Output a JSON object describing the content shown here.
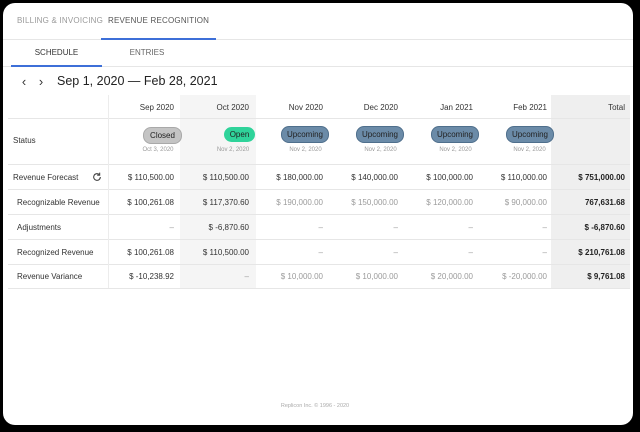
{
  "top_tabs": [
    "BILLING & INVOICING",
    "REVENUE RECOGNITION"
  ],
  "sub_tabs": [
    "SCHEDULE",
    "ENTRIES"
  ],
  "date_range": "Sep 1, 2020 — Feb 28, 2021",
  "columns": [
    "Sep 2020",
    "Oct 2020",
    "Nov 2020",
    "Dec 2020",
    "Jan 2021",
    "Feb 2021",
    "Total"
  ],
  "status": {
    "label": "Status",
    "items": [
      {
        "text": "Closed",
        "date": "Oct 3, 2020"
      },
      {
        "text": "Open",
        "date": "Nov 2, 2020"
      },
      {
        "text": "Upcoming",
        "date": "Nov 2, 2020"
      },
      {
        "text": "Upcoming",
        "date": "Nov 2, 2020"
      },
      {
        "text": "Upcoming",
        "date": "Nov 2, 2020"
      },
      {
        "text": "Upcoming",
        "date": "Nov 2, 2020"
      }
    ]
  },
  "rows": [
    {
      "label": "Revenue Forecast",
      "values": [
        "$ 110,500.00",
        "$ 110,500.00",
        "$ 180,000.00",
        "$ 140,000.00",
        "$ 100,000.00",
        "$ 110,000.00",
        "$ 751,000.00"
      ]
    },
    {
      "label": "Recognizable Revenue",
      "values": [
        "$ 100,261.08",
        "$ 117,370.60",
        "$ 190,000.00",
        "$ 150,000.00",
        "$ 120,000.00",
        "$ 90,000.00",
        "767,631.68"
      ]
    },
    {
      "label": "Adjustments",
      "values": [
        "–",
        "$ -6,870.60",
        "–",
        "–",
        "–",
        "–",
        "$ -6,870.60"
      ]
    },
    {
      "label": "Recognized Revenue",
      "values": [
        "$ 100,261.08",
        "$ 110,500.00",
        "–",
        "–",
        "–",
        "–",
        "$ 210,761.08"
      ]
    },
    {
      "label": "Revenue Variance",
      "values": [
        "$ -10,238.92",
        "–",
        "$ 10,000.00",
        "$ 10,000.00",
        "$ 20,000.00",
        "$ -20,000.00",
        "$ 9,761.08"
      ]
    }
  ],
  "footer": "Replicon Inc. © 1996 - 2020"
}
